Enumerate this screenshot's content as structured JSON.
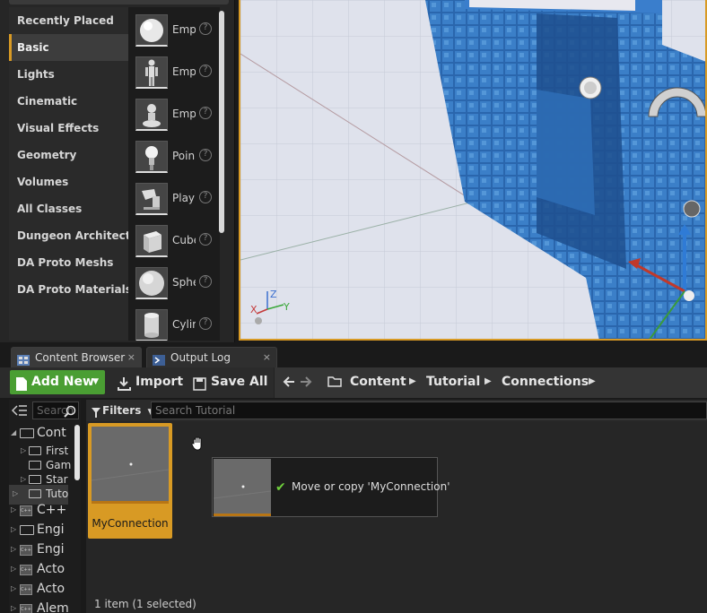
{
  "place_panel": {
    "categories": [
      "Recently Placed",
      "Basic",
      "Lights",
      "Cinematic",
      "Visual Effects",
      "Geometry",
      "Volumes",
      "All Classes",
      "Dungeon Architect",
      "DA Proto Meshs",
      "DA Proto Materials"
    ],
    "active_category": "Basic",
    "items": [
      {
        "name": "Emp",
        "icon": "sphere-icon"
      },
      {
        "name": "Emp",
        "icon": "character-icon"
      },
      {
        "name": "Emp",
        "icon": "pawn-icon"
      },
      {
        "name": "Poin",
        "icon": "light-bulb-icon"
      },
      {
        "name": "Play",
        "icon": "player-start-icon"
      },
      {
        "name": "Cube",
        "icon": "cube-icon"
      },
      {
        "name": "Sphe",
        "icon": "sphere-icon"
      },
      {
        "name": "Cylir",
        "icon": "cylinder-icon"
      }
    ],
    "help_glyph": "?"
  },
  "viewport": {
    "axis_labels": {
      "x": "X",
      "y": "Y",
      "z": "Z"
    }
  },
  "tabs": [
    {
      "label": "Content Browser",
      "active": true,
      "close": "×"
    },
    {
      "label": "Output Log",
      "active": false,
      "close": "×"
    }
  ],
  "toolbar": {
    "add_new": "Add New",
    "import": "Import",
    "save_all": "Save All",
    "breadcrumb": [
      "Content",
      "Tutorial",
      "Connections"
    ]
  },
  "tree": {
    "search_placeholder": "Search",
    "rows": [
      {
        "label": "Cont",
        "type": "folder-open"
      },
      {
        "label": "First",
        "type": "folder"
      },
      {
        "label": "Gam",
        "type": "folder"
      },
      {
        "label": "Star",
        "type": "folder"
      },
      {
        "label": "Tuto",
        "type": "folder"
      },
      {
        "label": "C++",
        "type": "cpp"
      },
      {
        "label": "Engi",
        "type": "folder"
      },
      {
        "label": "Engi",
        "type": "cpp"
      },
      {
        "label": "Acto",
        "type": "cpp"
      },
      {
        "label": "Acto",
        "type": "cpp"
      },
      {
        "label": "Alem",
        "type": "cpp"
      }
    ]
  },
  "filters": {
    "label": "Filters",
    "search_placeholder": "Search Tutorial"
  },
  "assets": {
    "items": [
      {
        "name": "MyConnection",
        "selected": true
      }
    ],
    "drag_message": "Move or copy 'MyConnection'",
    "status": "1 item (1 selected)"
  },
  "colors": {
    "accent": "#d89a24",
    "add_new": "#4a9e33",
    "check": "#6fcf3c",
    "tile_blue": "#2d6db5"
  }
}
